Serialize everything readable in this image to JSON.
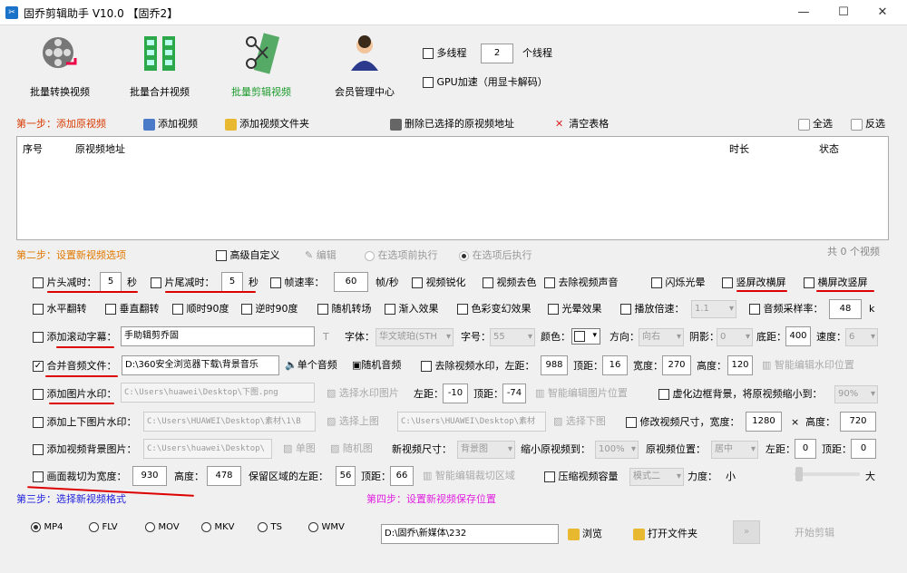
{
  "window": {
    "title": "固乔剪辑助手 V10.0 【固乔2】",
    "minimize": "—",
    "maximize": "☐",
    "close": "✕"
  },
  "toolbar": [
    {
      "label": "批量转换视频",
      "icon": "film-reel-icon"
    },
    {
      "label": "批量合并视频",
      "icon": "merge-grid-icon"
    },
    {
      "label": "批量剪辑视频",
      "icon": "scissors-film-icon"
    },
    {
      "label": "会员管理中心",
      "icon": "members-icon"
    }
  ],
  "threads": {
    "multi_label": "多线程",
    "count": "2",
    "unit": "个线程",
    "gpu_label": "GPU加速（用显卡解码）"
  },
  "step1": {
    "title": "第一步：添加原视频",
    "add_video": "添加视频",
    "add_folder": "添加视频文件夹",
    "delete_selected": "删除已选择的原视频地址",
    "clear_table": "清空表格",
    "select_all": "全选",
    "invert": "反选",
    "columns": {
      "index": "序号",
      "path": "原视频地址",
      "duration": "时长",
      "status": "状态"
    }
  },
  "step2": {
    "title": "第二步：设置新视频选项",
    "advanced": "高级自定义",
    "edit": "编辑",
    "before": "在选项前执行",
    "after": "在选项后执行",
    "count": "共 0 个视频"
  },
  "row1": {
    "head_cut": "片头减时：",
    "head_val": "5",
    "sec1": "秒",
    "tail_cut": "片尾减时：",
    "tail_val": "5",
    "sec2": "秒",
    "fps": "帧速率：",
    "fps_val": "60",
    "fps_unit": "帧/秒",
    "sharpen": "视频锐化",
    "decolor": "视频去色",
    "remove_audio": "去除视频声音",
    "flash": "闪烁光晕",
    "v2h": "竖屏改横屏",
    "h2v": "横屏改竖屏"
  },
  "row2": {
    "hflip": "水平翻转",
    "vflip": "垂直翻转",
    "cw90": "顺时90度",
    "ccw90": "逆时90度",
    "random_trans": "随机转场",
    "fadein": "渐入效果",
    "color_shift": "色彩变幻效果",
    "halo": "光晕效果",
    "speed": "播放倍速：",
    "speed_val": "1.1",
    "sample_rate": "音频采样率：",
    "sample_val": "48",
    "sample_unit": "k"
  },
  "row3": {
    "scroll_text": "添加滚动字幕：",
    "text_val": "手助辑剪乔固",
    "font": "字体：",
    "font_val": "华文琥珀(STH",
    "size": "字号：",
    "size_val": "55",
    "color": "颜色：",
    "direction": "方向：",
    "dir_val": "向右",
    "shadow": "阴影：",
    "shadow_val": "0",
    "bottom": "底距：",
    "bottom_val": "400",
    "speed": "速度：",
    "speed_val": "6"
  },
  "row4": {
    "merge_audio": "合并音频文件：",
    "audio_path": "D:\\360安全浏览器下载\\背景音乐",
    "single": "单个音频",
    "random": "随机音频",
    "remove_wm": "去除视频水印，左距：",
    "left_val": "988",
    "top": "顶距：",
    "top_val": "16",
    "width": "宽度：",
    "width_val": "270",
    "height": "高度：",
    "height_val": "120",
    "smart_wm": "智能编辑水印位置"
  },
  "row5": {
    "image_wm": "添加图片水印：",
    "img_path": "C:\\Users\\huawei\\Desktop\\下图.png",
    "select_img": "选择水印图片",
    "left": "左距：",
    "left_val": "-10",
    "top": "顶距：",
    "top_val": "-74",
    "smart_img": "智能编辑图片位置",
    "blur_bg": "虚化边框背景，将原视频缩小到：",
    "blur_val": "90%"
  },
  "row6": {
    "updown_wm": "添加上下图片水印：",
    "up_path": "C:\\Users\\HUAWEI\\Desktop\\素材\\1\\B",
    "select_up": "选择上图",
    "down_path": "C:\\Users\\HUAWEI\\Desktop\\素材",
    "select_down": "选择下图",
    "resize": "修改视频尺寸，宽度：",
    "w_val": "1280",
    "x": "×",
    "h_label": "高度：",
    "h_val": "720"
  },
  "row7": {
    "bg_image": "添加视频背景图片：",
    "bg_path": "C:\\Users\\huawei\\Desktop\\",
    "single_img": "单图",
    "random_img": "随机图",
    "new_size": "新视频尺寸：",
    "new_size_val": "背景图",
    "shrink": "缩小原视频到：",
    "shrink_val": "100%",
    "pos": "原视频位置：",
    "pos_val": "居中",
    "left": "左距：",
    "left_val": "0",
    "top": "顶距：",
    "top_val": "0"
  },
  "row8": {
    "crop": "画面裁切为宽度：",
    "crop_w": "930",
    "height": "高度：",
    "crop_h": "478",
    "keep_left": "保留区域的左距：",
    "keep_left_val": "56",
    "top": "顶距：",
    "top_val": "66",
    "smart_crop": "智能编辑裁切区域",
    "compress": "压缩视频容量",
    "mode_val": "模式二",
    "strength": "力度：",
    "small": "小",
    "large": "大",
    "strength_level": 0.02
  },
  "step3": {
    "title": "第三步：选择新视频格式",
    "formats": [
      "MP4",
      "FLV",
      "MOV",
      "MKV",
      "TS",
      "WMV"
    ],
    "selected": "MP4"
  },
  "step4": {
    "title": "第四步：设置新视频保存位置",
    "path": "D:\\固乔\\新媒体\\232",
    "browse": "浏览",
    "open_folder": "打开文件夹",
    "start": "开始剪辑"
  },
  "colors": {
    "accent_red": "#dd0000",
    "step_orange": "#e07800",
    "step_blue": "#2222dd",
    "step_magenta": "#e020e0"
  }
}
